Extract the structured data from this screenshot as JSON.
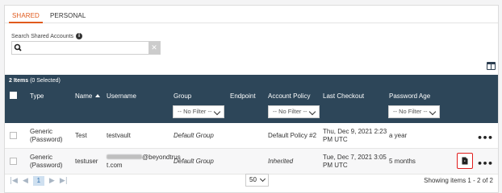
{
  "tabs": [
    {
      "label": "SHARED",
      "active": true
    },
    {
      "label": "PERSONAL",
      "active": false
    }
  ],
  "search": {
    "label": "Search Shared Accounts",
    "value": "",
    "placeholder": "",
    "clear_glyph": "✕"
  },
  "grid": {
    "items_count": "2 Items",
    "selected_text": "(0 Selected)",
    "columns": {
      "type": "Type",
      "name": "Name",
      "username": "Username",
      "group": "Group",
      "endpoint": "Endpoint",
      "account_policy": "Account Policy",
      "last_checkout": "Last Checkout",
      "password_age": "Password Age"
    },
    "sort": {
      "column": "name",
      "direction": "ascending"
    },
    "filter_label": "-- No Filter --",
    "rows": [
      {
        "type": [
          "Generic",
          "(Password)"
        ],
        "name": "Test",
        "username": [
          "testvault"
        ],
        "group": "Default Group",
        "endpoint": "",
        "account_policy": "Default Policy #2",
        "last_checkout": [
          "Thu, Dec 9, 2021 2:23",
          "PM UTC"
        ],
        "password_age": "a year",
        "actions": [
          "more-icon"
        ]
      },
      {
        "type": [
          "Generic",
          "(Password)"
        ],
        "name": "testuser",
        "username": [
          "@beyondtrus",
          "t.com"
        ],
        "group": "Default Group",
        "endpoint": "",
        "account_policy": "Inherited",
        "last_checkout": [
          "Tue, Dec 7, 2021 3:05",
          "PM UTC"
        ],
        "password_age": "5 months",
        "actions": [
          "checkout-icon",
          "more-icon"
        ],
        "checkout_highlight_color": "#e11d1d"
      }
    ]
  },
  "footer": {
    "current_page": "1",
    "page_size": "50",
    "showing": "Showing items 1 - 2 of 2"
  },
  "colors": {
    "accent": "#e05a1c",
    "header_bg": "#2d4659",
    "pager_current_bg": "#cfe0f0"
  }
}
